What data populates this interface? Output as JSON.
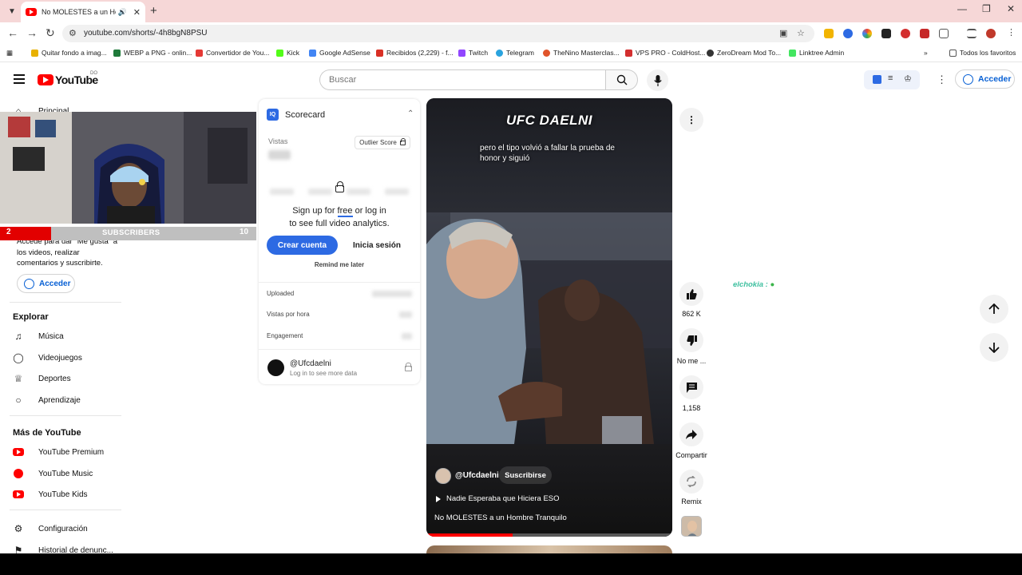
{
  "browser": {
    "tab_title": "No MOLESTES a un Hombre",
    "url": "youtube.com/shorts/-4h8bgN8PSU",
    "bookmarks": [
      {
        "label": "Quitar fondo a imag...",
        "color": "#e8b100"
      },
      {
        "label": "WEBP a PNG - onlin...",
        "color": "#1f7a3a"
      },
      {
        "label": "Convertidor de You...",
        "color": "#e53935"
      },
      {
        "label": "Kick",
        "color": "#53fc18"
      },
      {
        "label": "Google AdSense",
        "color": "#4285f4"
      },
      {
        "label": "Recibidos (2,229) - f...",
        "color": "#d93025"
      },
      {
        "label": "Twitch",
        "color": "#9146ff"
      },
      {
        "label": "Telegram",
        "color": "#2aa3de"
      },
      {
        "label": "TheNino Masterclas...",
        "color": "#e0542a"
      },
      {
        "label": "VPS PRO - ColdHost...",
        "color": "#d32f2f"
      },
      {
        "label": "ZeroDream Mod To...",
        "color": "#333333"
      },
      {
        "label": "Linktree Admin",
        "color": "#43e660"
      }
    ],
    "all_bookmarks": "Todos los favoritos"
  },
  "header": {
    "logo_text": "YouTube",
    "logo_suffix": "DO",
    "search_placeholder": "Buscar",
    "signin_label": "Acceder"
  },
  "sidebar": {
    "home_label": "Principal",
    "signin_prompt": "Accede para dar \"Me gusta\" a los videos, realizar comentarios y suscribirte.",
    "signin_label": "Acceder",
    "explore_heading": "Explorar",
    "explore_items": [
      "Música",
      "Videojuegos",
      "Deportes",
      "Aprendizaje"
    ],
    "more_heading": "Más de YouTube",
    "more_items": [
      "YouTube Premium",
      "YouTube Music",
      "YouTube Kids"
    ],
    "settings_items": [
      "Configuración",
      "Historial de denunc..."
    ]
  },
  "overlay": {
    "subscribers_label": "SUBSCRIBERS",
    "left_count": "2",
    "right_count": "10"
  },
  "scorecard": {
    "logo": "IQ",
    "title": "Scorecard",
    "views_label": "Vistas",
    "outlier_label": "Outlier Score",
    "signup_line1": "Sign up for",
    "signup_free": "free",
    "signup_line1_end": "or log in",
    "signup_line2": "to see full video analytics.",
    "create_account": "Crear cuenta",
    "login": "Inicia sesión",
    "remind": "Remind me later",
    "row_uploaded": "Uploaded",
    "row_views_per_hour": "Vistas por hora",
    "row_engagement": "Engagement",
    "channel_handle": "@Ufcdaelni",
    "channel_sub": "Log in to see more data"
  },
  "short": {
    "overlay_title": "UFC DAELNI",
    "caption": "pero el tipo volvió a fallar la prueba de honor y siguió",
    "channel": "@Ufcdaelni",
    "subscribe": "Suscribirse",
    "playlist": "Nadie Esperaba que Hiciera ESO",
    "title": "No MOLESTES a un Hombre Tranquilo",
    "progress": 0.35
  },
  "actions": {
    "likes": "862 K",
    "dislike": "No me ...",
    "comments": "1,158",
    "share": "Compartir",
    "remix": "Remix"
  },
  "chat_float": "elchokia :"
}
